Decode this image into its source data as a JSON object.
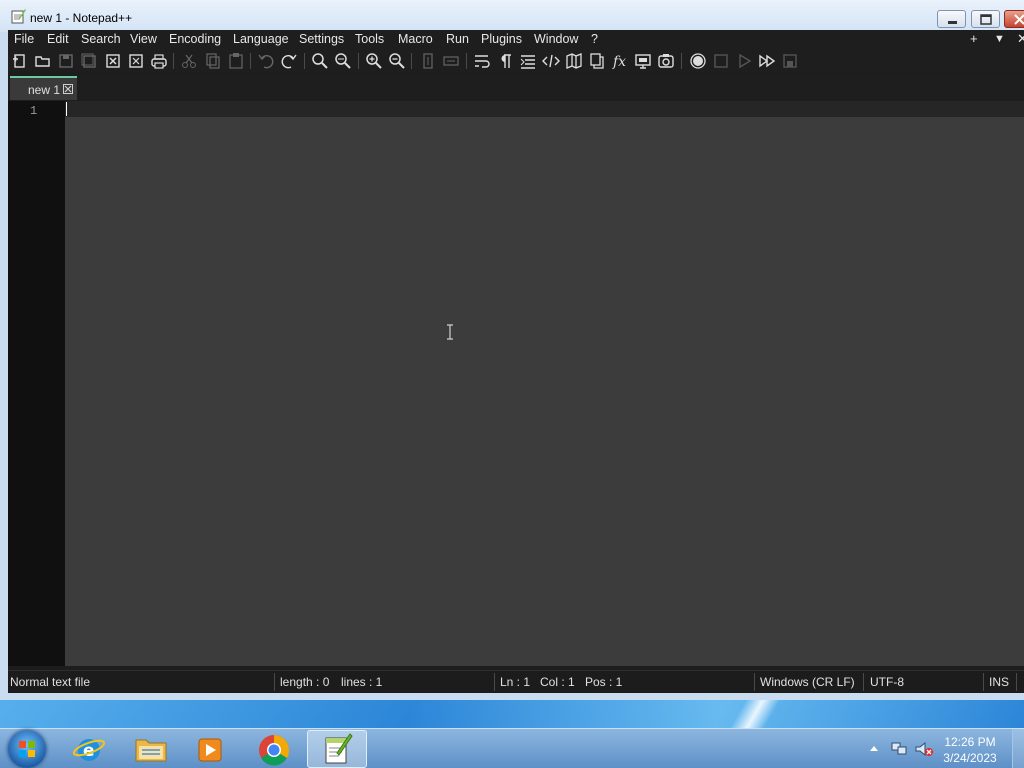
{
  "window": {
    "title": "new 1 - Notepad++"
  },
  "menu": {
    "items": [
      "File",
      "Edit",
      "Search",
      "View",
      "Encoding",
      "Language",
      "Settings",
      "Tools",
      "Macro",
      "Run",
      "Plugins",
      "Window",
      "?"
    ],
    "plus": "+",
    "dropdown": "▼",
    "close": "✕"
  },
  "toolbar": {
    "icons": [
      "new-file-icon",
      "open-file-icon",
      "save-icon",
      "save-all-icon",
      "close-icon",
      "close-all-icon",
      "print-icon",
      "cut-icon",
      "copy-icon",
      "paste-icon",
      "undo-icon",
      "redo-icon",
      "find-icon",
      "replace-icon",
      "zoom-in-icon",
      "zoom-out-icon",
      "sync-vertical-icon",
      "sync-horizontal-icon",
      "word-wrap-icon",
      "show-all-chars-icon",
      "indent-guide-icon",
      "xml-tag-icon",
      "document-map-icon",
      "document-list-icon",
      "function-list-icon",
      "monitoring-icon",
      "screenshot-icon",
      "record-macro-icon",
      "stop-record-icon",
      "play-macro-icon",
      "run-multiple-macro-icon",
      "save-macro-icon"
    ]
  },
  "tabs": [
    {
      "label": "new 1"
    }
  ],
  "editor": {
    "line_numbers": [
      "1"
    ],
    "content": ""
  },
  "status": {
    "file_type": "Normal text file",
    "length": "length : 0",
    "lines": "lines : 1",
    "ln": "Ln : 1",
    "col": "Col : 1",
    "pos": "Pos : 1",
    "eol": "Windows (CR LF)",
    "encoding": "UTF-8",
    "mode": "INS"
  },
  "taskbar": {
    "apps": [
      "internet-explorer-icon",
      "file-explorer-icon",
      "media-player-icon",
      "chrome-icon",
      "notepad-plus-plus-icon"
    ],
    "time": "12:26 PM",
    "date": "3/24/2023"
  },
  "colors": {
    "accent_tab": "#6fc7a3",
    "editor_bg": "#3c3c3c",
    "gutter_bg": "#101010"
  }
}
